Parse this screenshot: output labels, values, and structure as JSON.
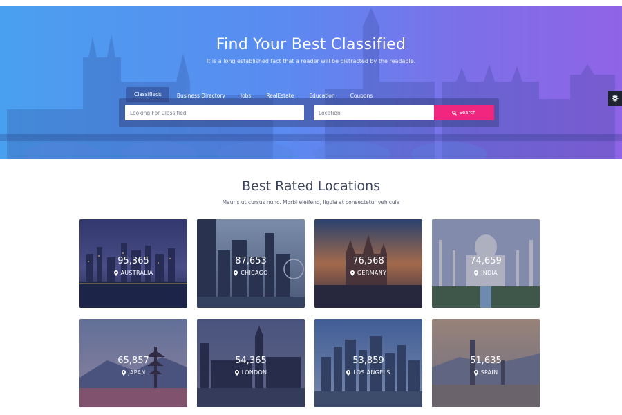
{
  "hero": {
    "title": "Find Your Best Classified",
    "subtitle": "It is a long established fact that a reader will be distracted by the readable."
  },
  "tabs": [
    {
      "label": "Classifieds",
      "active": true
    },
    {
      "label": "Business Directory",
      "active": false
    },
    {
      "label": "Jobs",
      "active": false
    },
    {
      "label": "RealEstate",
      "active": false
    },
    {
      "label": "Education",
      "active": false
    },
    {
      "label": "Coupons",
      "active": false
    }
  ],
  "search": {
    "classified_placeholder": "Looking For Classified",
    "location_placeholder": "Location",
    "button_label": "Search",
    "button_icon": "search-icon"
  },
  "settings": {
    "icon": "gear-icon"
  },
  "locations_section": {
    "title": "Best Rated Locations",
    "subtitle": "Mauris ut cursus nunc. Morbi eleifend, ligula at consectetur vehicula"
  },
  "locations": [
    {
      "count": "95,365",
      "name": "AUSTRALIA",
      "scene": "night-harbor"
    },
    {
      "count": "87,653",
      "name": "CHICAGO",
      "scene": "skyscrapers"
    },
    {
      "count": "76,568",
      "name": "GERMANY",
      "scene": "castle-sunset"
    },
    {
      "count": "74,659",
      "name": "INDIA",
      "scene": "taj-mahal"
    },
    {
      "count": "65,857",
      "name": "JAPAN",
      "scene": "pagoda"
    },
    {
      "count": "54,365",
      "name": "LONDON",
      "scene": "big-ben-dusk"
    },
    {
      "count": "53,859",
      "name": "LOS ANGELS",
      "scene": "downtown-day"
    },
    {
      "count": "51,635",
      "name": "SPAIN",
      "scene": "city-sunset"
    }
  ],
  "colors": {
    "accent_pink": "#f1277f",
    "hero_gradient_start": "#4aa0f0",
    "hero_gradient_end": "#8f64e6",
    "text_dark": "#3b4158"
  }
}
